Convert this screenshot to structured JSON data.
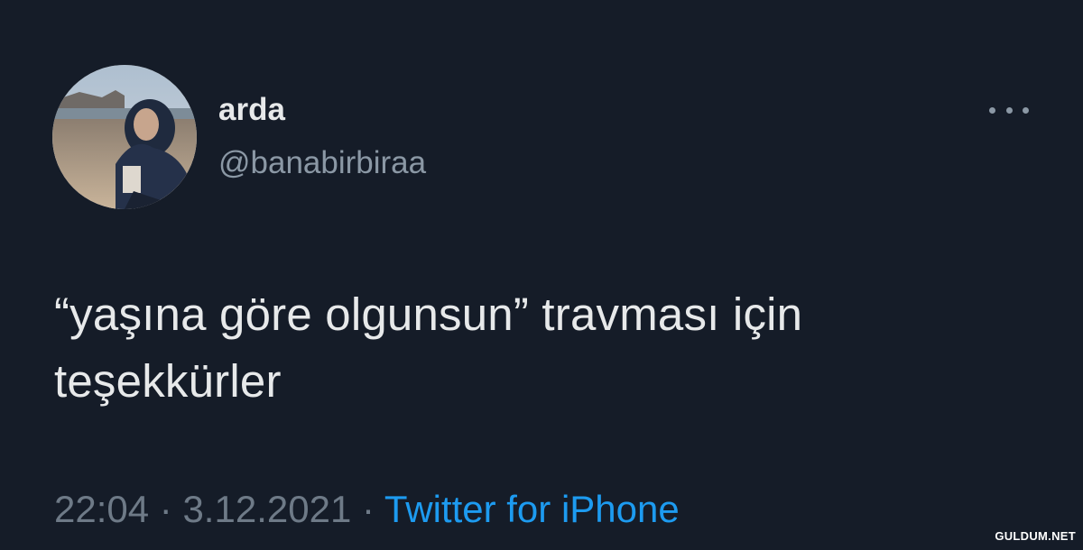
{
  "tweet": {
    "display_name": "arda",
    "handle": "@banabirbiraa",
    "text_line1": "“yaşına göre olgunsun” travması için",
    "text_line2": "teşekkürler",
    "time": "22:04",
    "separator": "·",
    "date": "3.12.2021",
    "source": "Twitter for iPhone",
    "more_icon": "more-horizontal-icon"
  },
  "watermark": "GULDUM.NET",
  "colors": {
    "background": "#151c28",
    "text": "#e7e9ea",
    "secondary": "#8b98a5",
    "link": "#1d9bf0"
  }
}
